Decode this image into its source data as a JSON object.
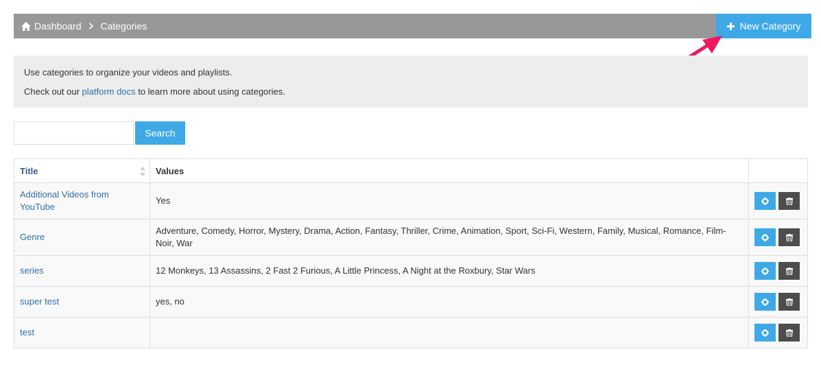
{
  "header": {
    "breadcrumb": [
      {
        "label": "Dashboard",
        "icon": "home-icon"
      },
      {
        "label": "Categories"
      }
    ],
    "new_button": {
      "label": "New Category",
      "icon": "plus-icon"
    },
    "bar_color": "#989898",
    "accent_color": "#3ea9e6"
  },
  "info": {
    "line1": "Use categories to organize your videos and playlists.",
    "line2_prefix": "Check out our ",
    "line2_link": "platform docs",
    "line2_suffix": " to learn more about using categories."
  },
  "search": {
    "value": "",
    "placeholder": "",
    "button_label": "Search"
  },
  "table": {
    "columns": [
      "Title",
      "Values",
      ""
    ],
    "rows": [
      {
        "title": "Additional Videos from YouTube",
        "values": "Yes"
      },
      {
        "title": "Genre",
        "values": "Adventure, Comedy, Horror, Mystery, Drama, Action, Fantasy, Thriller, Crime, Animation, Sport, Sci-Fi, Western, Family, Musical, Romance, Film-Noir, War"
      },
      {
        "title": "series",
        "values": "12 Monkeys, 13 Assassins, 2 Fast 2 Furious, A Little Princess, A Night at the Roxbury, Star Wars"
      },
      {
        "title": "super test",
        "values": "yes, no"
      },
      {
        "title": "test",
        "values": ""
      }
    ],
    "row_actions": [
      "gear-icon",
      "trash-icon"
    ]
  },
  "annotation": {
    "arrow_color": "#f0195f"
  }
}
